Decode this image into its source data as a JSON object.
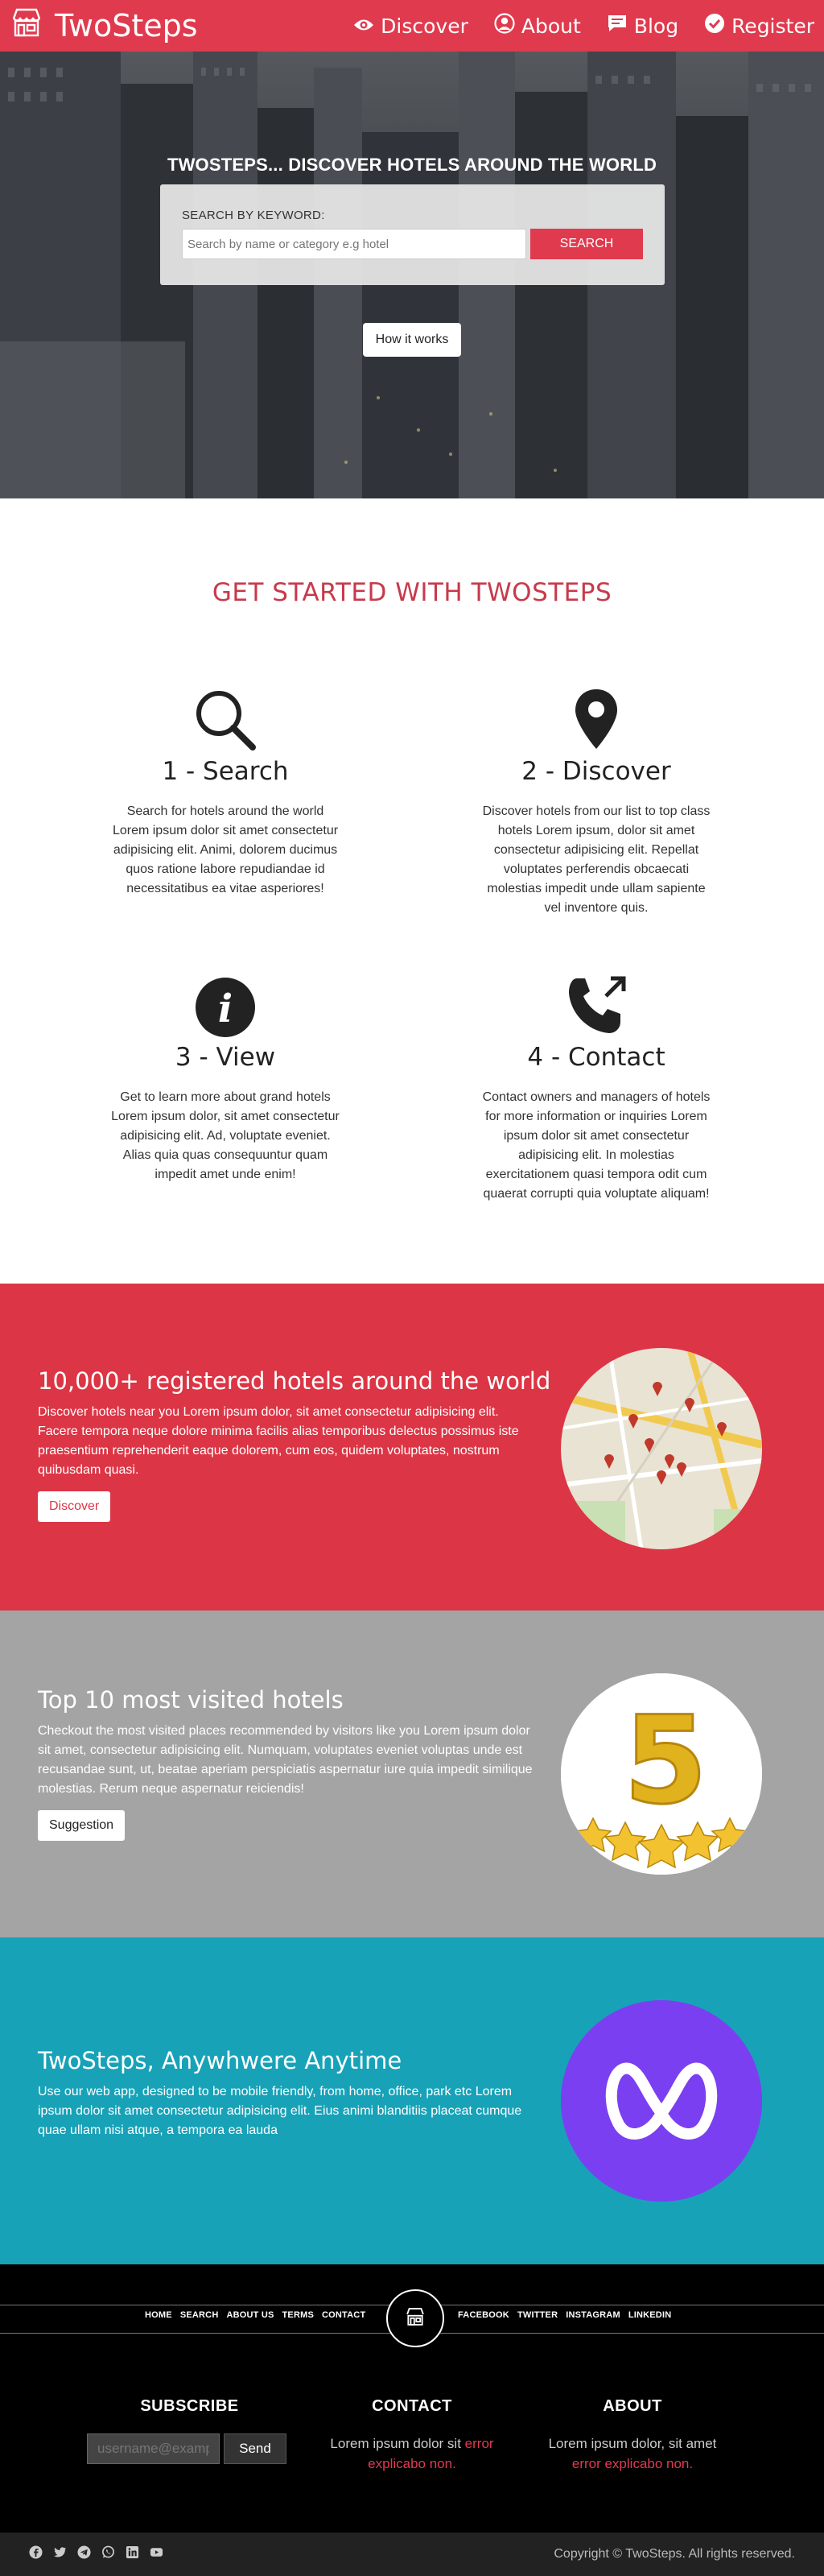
{
  "nav": {
    "brand": "TwoSteps",
    "links": [
      {
        "label": "Discover",
        "icon": "eye-icon"
      },
      {
        "label": "About",
        "icon": "user-circle-icon"
      },
      {
        "label": "Blog",
        "icon": "chat-bubble-icon"
      },
      {
        "label": "Register",
        "icon": "check-circle-icon"
      }
    ],
    "color": "#e03a4e"
  },
  "hero": {
    "title": "TWOSTEPS... DISCOVER HOTELS AROUND THE WORLD",
    "search_label": "SEARCH BY KEYWORD:",
    "search_placeholder": "Search by name or category e.g hotel",
    "search_button": "SEARCH",
    "how_button": "How it works"
  },
  "started": {
    "title": "GET STARTED WITH TWOSTEPS",
    "steps": [
      {
        "icon": "search-icon",
        "title": "1 - Search",
        "text": "Search for hotels around the world Lorem ipsum dolor sit amet consectetur adipisicing elit. Animi, dolorem ducimus quos ratione labore repudiandae id necessitatibus ea vitae asperiores!"
      },
      {
        "icon": "map-pin-icon",
        "title": "2 - Discover",
        "text": "Discover hotels from our list to top class hotels Lorem ipsum, dolor sit amet consectetur adipisicing elit. Repellat voluptates perferendis obcaecati molestias impedit unde ullam sapiente vel inventore quis."
      },
      {
        "icon": "info-icon",
        "title": "3 - View",
        "text": "Get to learn more about grand hotels Lorem ipsum dolor, sit amet consectetur adipisicing elit. Ad, voluptate eveniet. Alias quia quas consequuntur quam impedit amet unde enim!"
      },
      {
        "icon": "phone-outgoing-icon",
        "title": "4 - Contact",
        "text": "Contact owners and managers of hotels for more information or inquiries Lorem ipsum dolor sit amet consectetur adipisicing elit. In molestias exercitationem quasi tempora odit cum quaerat corrupti quia voluptate aliquam!"
      }
    ]
  },
  "bands": [
    {
      "title": "10,000+ registered hotels around the world",
      "text": "Discover hotels near you Lorem ipsum dolor, sit amet consectetur adipisicing elit. Facere tempora neque dolore minima facilis alias temporibus delectus possimus iste praesentium reprehenderit eaque dolorem, cum eos, quidem voluptates, nostrum quibusdam quasi.",
      "button": "Discover",
      "bg": "#dc3545",
      "image": "map-image"
    },
    {
      "title": "Top 10 most visited hotels",
      "text": "Checkout the most visited places recommended by visitors like you Lorem ipsum dolor sit amet, consectetur adipisicing elit. Numquam, voluptates eveniet voluptas unde est recusandae sunt, ut, beatae aperiam perspiciatis aspernatur iure quia impedit similique molestias. Rerum neque aspernatur reiciendis!",
      "button": "Suggestion",
      "bg": "#a4a4a4",
      "image": "five-stars-image"
    },
    {
      "title": "TwoSteps, Anywhwere Anytime",
      "text": "Use our web app, designed to be mobile friendly, from home, office, park etc Lorem ipsum dolor sit amet consectetur adipisicing elit. Eius animi blanditiis placeat cumque quae ullam nisi atque, a tempora ea lauda",
      "bg": "#17a2b8",
      "image": "app-logo-image"
    }
  ],
  "footer": {
    "left_links": [
      "HOME",
      "SEARCH",
      "ABOUT US",
      "TERMS",
      "CONTACT"
    ],
    "right_links": [
      "FACEBOOK",
      "TWITTER",
      "INSTAGRAM",
      "LINKEDIN"
    ],
    "subscribe": {
      "title": "SUBSCRIBE",
      "placeholder": "username@example.com",
      "button": "Send"
    },
    "contact": {
      "title": "CONTACT",
      "text": "Lorem ipsum dolor sit",
      "error": "error explicabo non."
    },
    "about": {
      "title": "ABOUT",
      "text": "Lorem ipsum dolor, sit amet",
      "error": "error explicabo non."
    },
    "social_icons": [
      "facebook-icon",
      "twitter-icon",
      "telegram-icon",
      "whatsapp-icon",
      "linkedin-icon",
      "youtube-icon"
    ],
    "copyright": "Copyright © TwoSteps. All rights reserved."
  }
}
